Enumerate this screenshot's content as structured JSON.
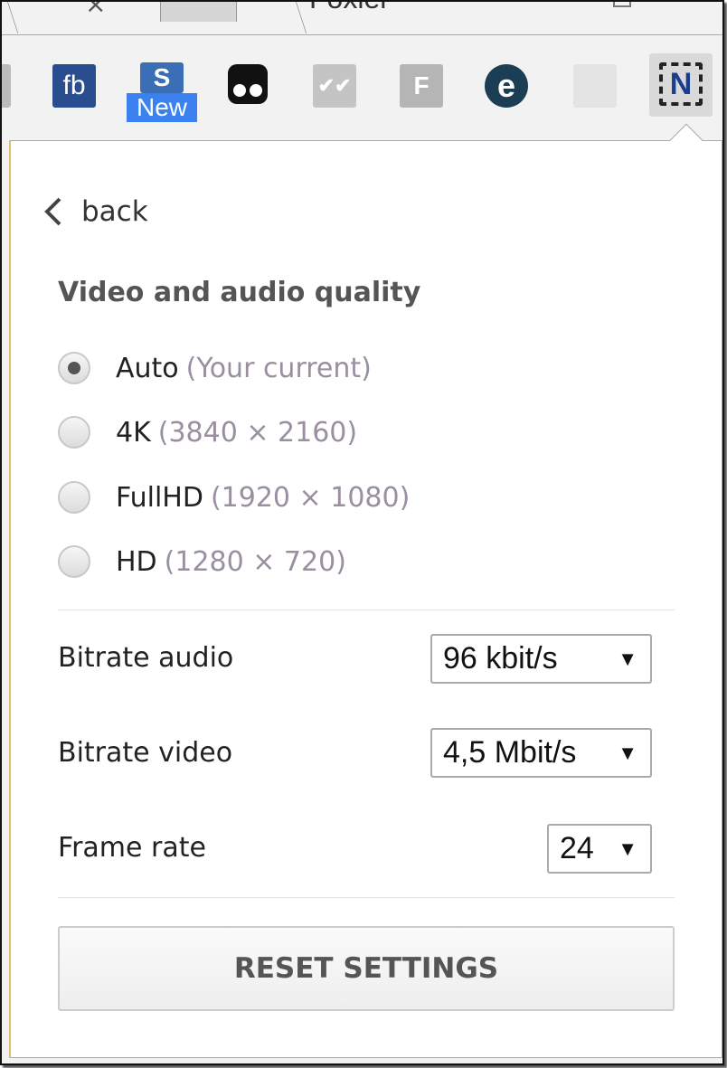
{
  "browser": {
    "window_title": "Foxiel",
    "extensions": [
      {
        "name": "fb",
        "label": "fb",
        "color": "#2a4d8f"
      },
      {
        "name": "s-new",
        "label": "S",
        "badge": "New",
        "color": "#3b6fb5",
        "badge_color": "#3b82f0"
      },
      {
        "name": "tracker",
        "label": "",
        "color": "#111111"
      },
      {
        "name": "mail-check",
        "label": "",
        "color": "#bdbdbd"
      },
      {
        "name": "f",
        "label": "F",
        "color": "#b5b5b5"
      },
      {
        "name": "e",
        "label": "e",
        "color": "#1c3e55"
      },
      {
        "name": "faded",
        "label": "",
        "color": "#e0e0e0"
      },
      {
        "name": "note-plus",
        "label": "N",
        "color": "#1a3d8f"
      }
    ]
  },
  "popup": {
    "back_label": "back",
    "heading": "Video and audio quality",
    "quality_options": [
      {
        "label": "Auto",
        "hint": "(Your current)",
        "selected": true
      },
      {
        "label": "4K",
        "hint": "(3840 × 2160)",
        "selected": false
      },
      {
        "label": "FullHD",
        "hint": "(1920 × 1080)",
        "selected": false
      },
      {
        "label": "HD",
        "hint": "(1280 × 720)",
        "selected": false
      }
    ],
    "settings": [
      {
        "label": "Bitrate audio",
        "value": "96 kbit/s"
      },
      {
        "label": "Bitrate video",
        "value": "4,5 Mbit/s"
      },
      {
        "label": "Frame rate",
        "value": "24"
      }
    ],
    "reset_label": "RESET SETTINGS"
  }
}
